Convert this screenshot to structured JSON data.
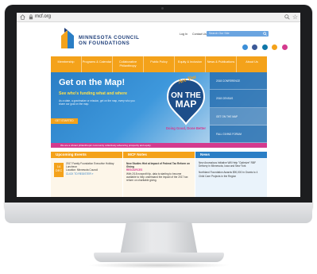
{
  "browser": {
    "url": "mcf.org",
    "star_icon": "☆"
  },
  "header": {
    "logo_line1": "MINNESOTA COUNCIL",
    "logo_line2": "ON FOUNDATIONS",
    "login": "Log In",
    "contact": "Contact Us",
    "search_placeholder": "Search Our Site"
  },
  "colors": {
    "orange": "#f4a21a",
    "blue": "#2a7ec5",
    "pink": "#d43a8e",
    "navy": "#1f3f7a"
  },
  "nav": {
    "items": [
      "Membership",
      "Programs & Calendar",
      "Collaborative Philanthropy",
      "Public Policy",
      "Equity & Inclusion",
      "News & Publications",
      "About Us"
    ]
  },
  "hero": {
    "title": "Get on the Map!",
    "subtitle": "See who's funding what and where",
    "body": "As a state, a grantmaker or mission, get on the map, every who you share our goal on the map.",
    "button": "GET STARTED",
    "badge_top": "Are You",
    "badge_main1": "ON THE",
    "badge_main2": "MAP",
    "badge_tag": "Doing Good, Done Better",
    "side_items": [
      "2018 CONFERENCE",
      "2018 CENSUS",
      "GET ON THE MAP",
      "FALL GIVING FORUM"
    ]
  },
  "banner": {
    "text": "We are a vibrant philanthropic community collectively advancing prosperity and equity."
  },
  "events": {
    "heading": "Upcoming Events",
    "month": "DEC",
    "day": "14",
    "title": "2017 Family Foundation Executive Holiday Luncheon",
    "location": "Location: Minnesota Council",
    "link": "CLICK TO REGISTER »"
  },
  "hot": {
    "heading": "MCF Notes",
    "title": "New Studies Hint at Impact of Federal Tax Reform on Giving",
    "tag": "RESOURCES",
    "body": "With 2/18 nonprofit tip, data is starting to become available to help understand the impact of the 2017 tax reform on charitable giving."
  },
  "news": {
    "heading": "News",
    "item1": "New Anomalous Initiative Will Help \"Optimize\" RBF Delivery in Minnesota, Iowa and New York",
    "item2": "Northland Foundation Awards $90,000 in Grants to 4 Child Care Projects in the Region"
  }
}
